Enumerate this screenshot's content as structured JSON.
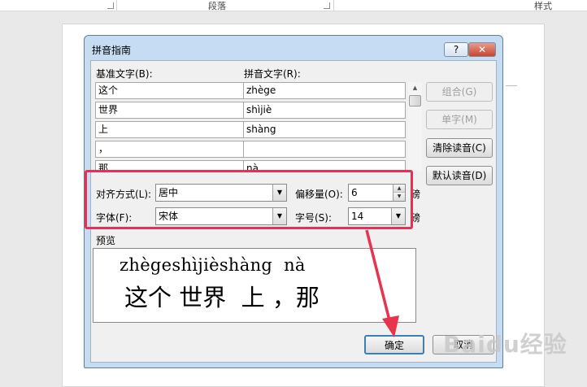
{
  "ribbon": {
    "group_paragraph": "段落",
    "group_styles": "样式"
  },
  "dialog": {
    "title": "拼音指南",
    "help_label": "?",
    "close_label": "✕",
    "base_header": "基准文字(B):",
    "ruby_header": "拼音文字(R):",
    "rows": [
      {
        "base": "这个",
        "ruby": "zhège"
      },
      {
        "base": "世界",
        "ruby": "shìjiè"
      },
      {
        "base": "上",
        "ruby": "shàng"
      },
      {
        "base": "，",
        "ruby": ""
      },
      {
        "base": "那",
        "ruby": "nà"
      }
    ],
    "buttons": {
      "combine": "组合(G)",
      "mono": "单字(M)",
      "clear": "清除读音(C)",
      "default": "默认读音(D)"
    },
    "alignment": {
      "label": "对齐方式(L):",
      "value": "居中"
    },
    "offset": {
      "label": "偏移量(O):",
      "value": "6",
      "unit": "磅"
    },
    "font": {
      "label": "字体(F):",
      "value": "宋体"
    },
    "size": {
      "label": "字号(S):",
      "value": "14",
      "unit": "磅"
    },
    "preview": {
      "label": "预览",
      "pinyin": "zhègeshìjièshàng  nà",
      "text": "这个 世界  上 ，那"
    },
    "ok_label": "确定",
    "cancel_label": "取消"
  },
  "watermark": "Baidu经验",
  "colors": {
    "highlight_box": "#ea2f52",
    "dialog_frame": "#c6dcf2"
  },
  "icons": [
    "dialog-launcher-icon",
    "help-icon",
    "close-icon",
    "dropdown-arrow-icon",
    "spin-up-icon",
    "spin-down-icon",
    "red-arrow-annotation"
  ]
}
